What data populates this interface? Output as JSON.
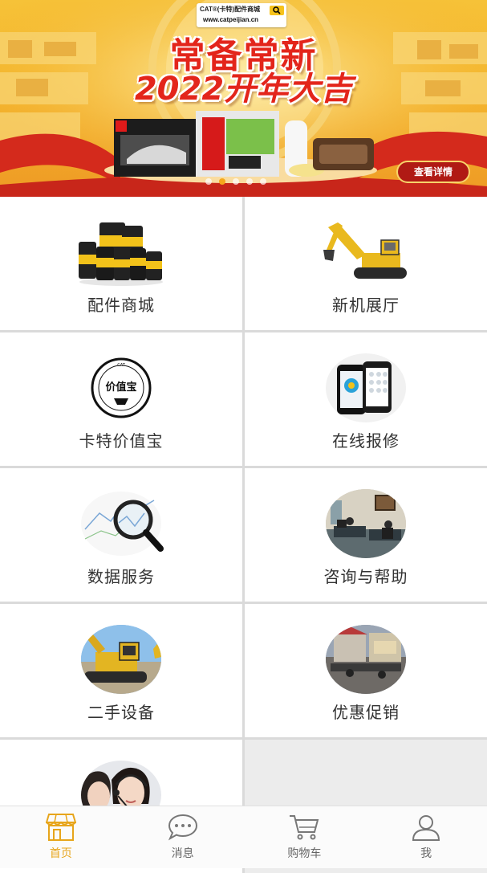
{
  "banner": {
    "brand_name": "CAT®(卡特)配件商城",
    "brand_url": "www.catpeijian.cn",
    "headline_line1": "常备常新",
    "headline_line2": "2022开年大吉",
    "cta_label": "查看详情",
    "active_slide": 1,
    "slide_count": 5
  },
  "grid": {
    "items": [
      {
        "label": "配件商城",
        "icon": "oil-bottles-image"
      },
      {
        "label": "新机展厅",
        "icon": "excavator-image"
      },
      {
        "label": "卡特价值宝",
        "icon": "value-treasure-logo",
        "logo_text": "价值宝"
      },
      {
        "label": "在线报修",
        "icon": "smartphones-image"
      },
      {
        "label": "数据服务",
        "icon": "magnifier-chart-image"
      },
      {
        "label": "咨询与帮助",
        "icon": "office-photo"
      },
      {
        "label": "二手设备",
        "icon": "used-excavator-photo"
      },
      {
        "label": "优惠促销",
        "icon": "promo-booth-photo"
      },
      {
        "label": "",
        "icon": "customer-service-photo"
      }
    ]
  },
  "tabbar": {
    "tabs": [
      {
        "label": "首页",
        "icon": "store-icon",
        "active": true
      },
      {
        "label": "消息",
        "icon": "chat-bubble-icon",
        "active": false
      },
      {
        "label": "购物车",
        "icon": "shopping-cart-icon",
        "active": false
      },
      {
        "label": "我",
        "icon": "user-icon",
        "active": false
      }
    ]
  },
  "colors": {
    "accent": "#e7a51b",
    "headline_red": "#e3251b",
    "banner_yellow": "#f4b52c",
    "tab_inactive": "#666666"
  }
}
